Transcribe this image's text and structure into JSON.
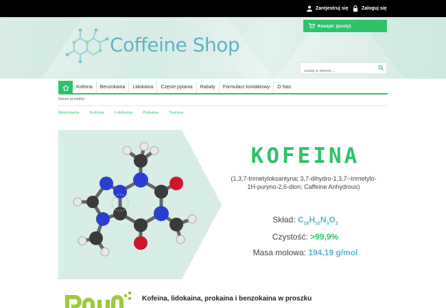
{
  "topbar": {
    "register_label": "Zarejestruj się",
    "login_label": "Zaloguj się"
  },
  "header": {
    "logo_text": "Coffeine Shop",
    "cart_label": "Koszyk: (pusty)",
    "search_placeholder": "szukaj w sklepie..."
  },
  "nav": {
    "items": [
      "Kofeina",
      "Benzokaina",
      "Lidokaina",
      "Częste pytania",
      "Rabaty",
      "Formularz kontaktowy",
      "O Nas"
    ]
  },
  "breadcrumb": "Nasze produkty",
  "subcategories": [
    "Benzokaina",
    "Kofeina",
    "Lidokaina",
    "Prokaina",
    "Tauryna"
  ],
  "product": {
    "title": "KOFEINA",
    "synonyms": "(1,3,7-trimetyloksantyna; 3,7-dihydro-1,3,7--trimetylo-1H-puryno-2,6-dion; Caffeine Anhydrous)",
    "formula_label": "Skład:",
    "formula": {
      "c": "C",
      "c_n": "18",
      "h": "H",
      "h_n": "10",
      "n": "N",
      "n_n": "4",
      "o": "O",
      "o_n": "2"
    },
    "purity_label": "Czystość:",
    "purity_value": ">99,9%",
    "mass_label": "Masa molowa:",
    "mass_value": "194,19 g/mol"
  },
  "footer_headline": "Kofeina, lidokaina, prokaina i benzokaina w proszku",
  "colors": {
    "accent": "#2ec36a",
    "logo": "#5fb3c6",
    "topbar": "#000000"
  }
}
